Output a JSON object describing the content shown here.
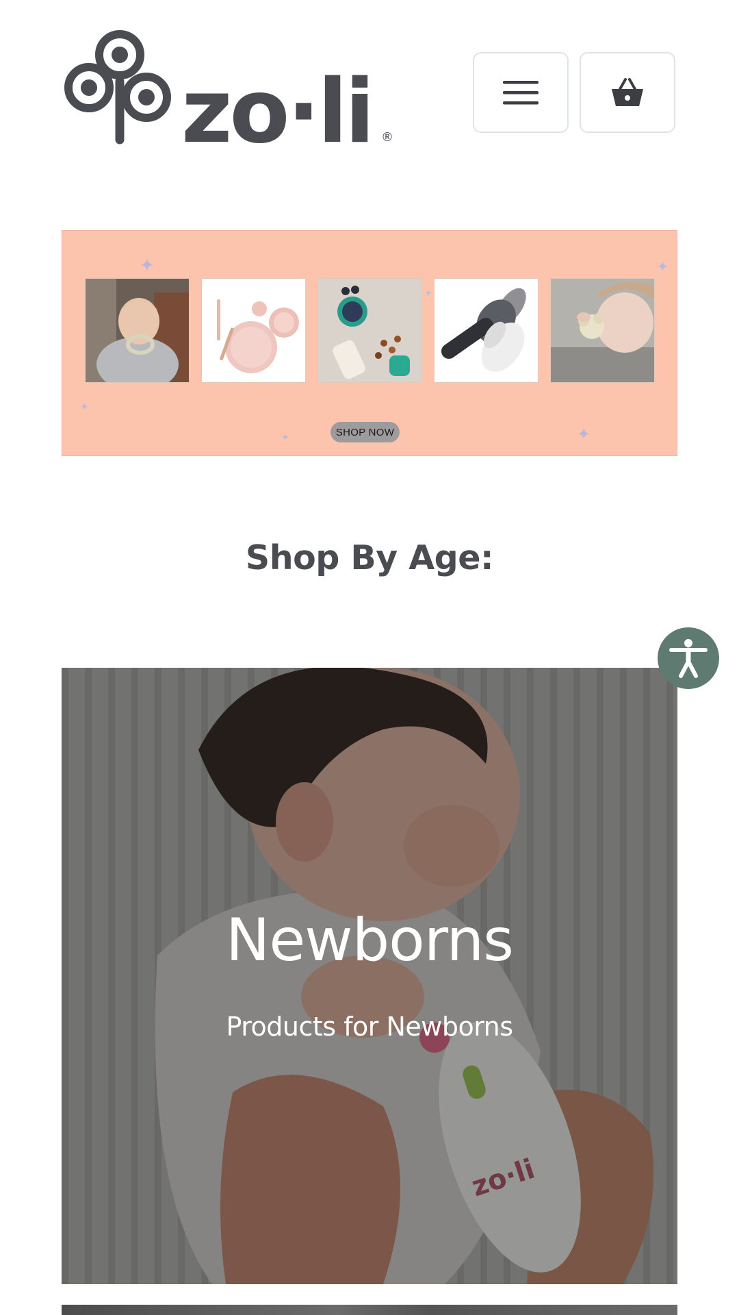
{
  "header": {
    "logo": {
      "icon": "zoli-flower-logo",
      "wordmark": "zo·li",
      "registered_mark": "®",
      "color": "#4a4c52"
    },
    "menu_button": {
      "icon": "hamburger-menu-icon"
    },
    "cart_button": {
      "icon": "shopping-basket-icon"
    }
  },
  "promo_banner": {
    "background_color": "#fcc3ad",
    "cta_label": "SHOP NOW",
    "product_tiles": [
      {
        "name": "baby-with-teether-ring-photo"
      },
      {
        "name": "pink-plate-and-bowl-set-photo"
      },
      {
        "name": "snack-containers-photo"
      },
      {
        "name": "grey-teether-brush-photo"
      },
      {
        "name": "baby-with-flower-teether-photo"
      }
    ]
  },
  "shop_by_age": {
    "heading": "Shop By Age:",
    "categories": [
      {
        "title": "Newborns",
        "subtitle": "Products for Newborns",
        "image": "newborn-nail-trimmer-photo"
      }
    ]
  },
  "accessibility": {
    "icon": "accessibility-person-icon",
    "color": "#5f7b71"
  }
}
